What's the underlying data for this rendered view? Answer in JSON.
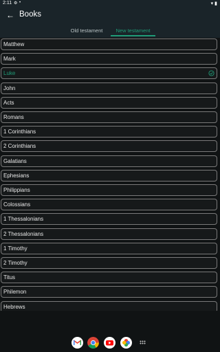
{
  "status": {
    "time": "2:11",
    "battery_icon": "battery-icon",
    "wifi_icon": "wifi-icon"
  },
  "appbar": {
    "title": "Books",
    "back_icon": "arrow-back-icon"
  },
  "tabs": {
    "old": "Old testament",
    "new": "New testament",
    "selected": "new"
  },
  "books": [
    "Matthew",
    "Mark",
    "Luke",
    "John",
    "Acts",
    "Romans",
    "1 Corinthians",
    "2 Corinthians",
    "Galatians",
    "Ephesians",
    "Philippians",
    "Colossians",
    "1 Thessalonians",
    "2 Thessalonians",
    "1 Timothy",
    "2 Timothy",
    "Titus",
    "Philemon",
    "Hebrews"
  ],
  "selected_book": "Luke",
  "colors": {
    "accent": "#1f9b77",
    "background": "#101314",
    "appbar": "#1a2429"
  },
  "dock": [
    "gmail-icon",
    "chrome-icon",
    "youtube-icon",
    "photos-icon",
    "apps-grid-icon"
  ]
}
